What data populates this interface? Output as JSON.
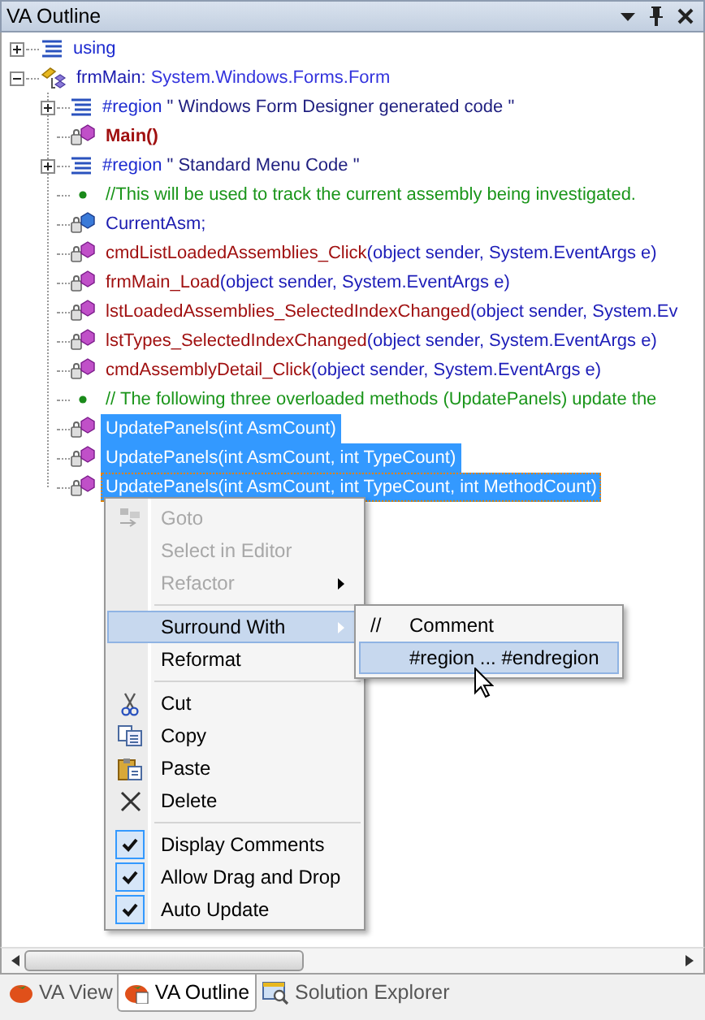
{
  "window": {
    "title": "VA Outline"
  },
  "tree": [
    {
      "kind": "region",
      "name": "using",
      "expanded": false
    },
    {
      "kind": "class",
      "name": "frmMain:",
      "params": " System.Windows.Forms.Form",
      "expanded": true,
      "children": [
        {
          "kind": "region",
          "name": "#region",
          "params": " \" Windows Form Designer generated code \"",
          "expanded": false,
          "selected": false,
          "focused": false
        },
        {
          "kind": "method",
          "name": "Main()",
          "bold": true,
          "selected": false,
          "focused": false
        },
        {
          "kind": "region",
          "name": "#region",
          "params": " \" Standard Menu Code \"",
          "expanded": false,
          "selected": false,
          "focused": false
        },
        {
          "kind": "comment",
          "name": "//This will be used to track the current assembly being investigated.",
          "selected": false,
          "focused": false
        },
        {
          "kind": "field",
          "name": "CurrentAsm;",
          "selected": false,
          "focused": false
        },
        {
          "kind": "method",
          "name": "cmdListLoadedAssemblies_Click",
          "params": "(object sender, System.EventArgs e)",
          "bold": false,
          "selected": false,
          "focused": false
        },
        {
          "kind": "method",
          "name": "frmMain_Load",
          "params": "(object sender, System.EventArgs e)",
          "bold": false,
          "selected": false,
          "focused": false
        },
        {
          "kind": "method",
          "name": "lstLoadedAssemblies_SelectedIndexChanged",
          "params": "(object sender, System.Ev",
          "bold": false,
          "selected": false,
          "focused": false
        },
        {
          "kind": "method",
          "name": "lstTypes_SelectedIndexChanged",
          "params": "(object sender, System.EventArgs e)",
          "bold": false,
          "selected": false,
          "focused": false
        },
        {
          "kind": "method",
          "name": "cmdAssemblyDetail_Click",
          "params": "(object sender, System.EventArgs e)",
          "bold": false,
          "selected": false,
          "focused": false
        },
        {
          "kind": "comment",
          "name": "// The following three overloaded methods (UpdatePanels) update the",
          "selected": false,
          "focused": false
        },
        {
          "kind": "method",
          "name": "UpdatePanels(int AsmCount)",
          "bold": false,
          "selected": true,
          "focused": false
        },
        {
          "kind": "method",
          "name": "UpdatePanels(int AsmCount, int TypeCount)",
          "bold": false,
          "selected": true,
          "focused": false
        },
        {
          "kind": "method",
          "name": "UpdatePanels(int AsmCount, int TypeCount, int MethodCount)",
          "bold": false,
          "selected": true,
          "focused": true
        }
      ]
    }
  ],
  "context_menu": {
    "items": [
      {
        "kind": "command",
        "label": "Goto",
        "disabled": true,
        "highlighted": false,
        "submenu": false
      },
      {
        "kind": "command",
        "label": "Select in Editor",
        "disabled": true,
        "highlighted": false,
        "submenu": false
      },
      {
        "kind": "command",
        "label": "Refactor",
        "disabled": true,
        "highlighted": false,
        "submenu": true
      },
      {
        "kind": "separator"
      },
      {
        "kind": "command",
        "label": "Surround With",
        "disabled": false,
        "highlighted": true,
        "submenu": true
      },
      {
        "kind": "command",
        "label": "Reformat",
        "disabled": false,
        "highlighted": false,
        "submenu": false
      },
      {
        "kind": "separator"
      },
      {
        "kind": "command",
        "label": "Cut",
        "disabled": false,
        "highlighted": false,
        "submenu": false
      },
      {
        "kind": "command",
        "label": "Copy",
        "disabled": false,
        "highlighted": false,
        "submenu": false
      },
      {
        "kind": "command",
        "label": "Paste",
        "disabled": false,
        "highlighted": false,
        "submenu": false
      },
      {
        "kind": "command",
        "label": "Delete",
        "disabled": false,
        "highlighted": false,
        "submenu": false
      },
      {
        "kind": "separator"
      },
      {
        "kind": "toggle",
        "label": "Display Comments",
        "checked": true
      },
      {
        "kind": "toggle",
        "label": "Allow Drag and Drop",
        "checked": true
      },
      {
        "kind": "toggle",
        "label": "Auto Update",
        "checked": true
      }
    ]
  },
  "submenu": {
    "items": [
      {
        "glyph": "//",
        "label": "Comment",
        "highlighted": false
      },
      {
        "label": "#region ... #endregion",
        "highlighted": true
      }
    ]
  },
  "tabs": [
    {
      "label": "VA View",
      "selected": false
    },
    {
      "label": "VA Outline",
      "selected": true
    },
    {
      "label": "Solution Explorer",
      "selected": false
    }
  ]
}
